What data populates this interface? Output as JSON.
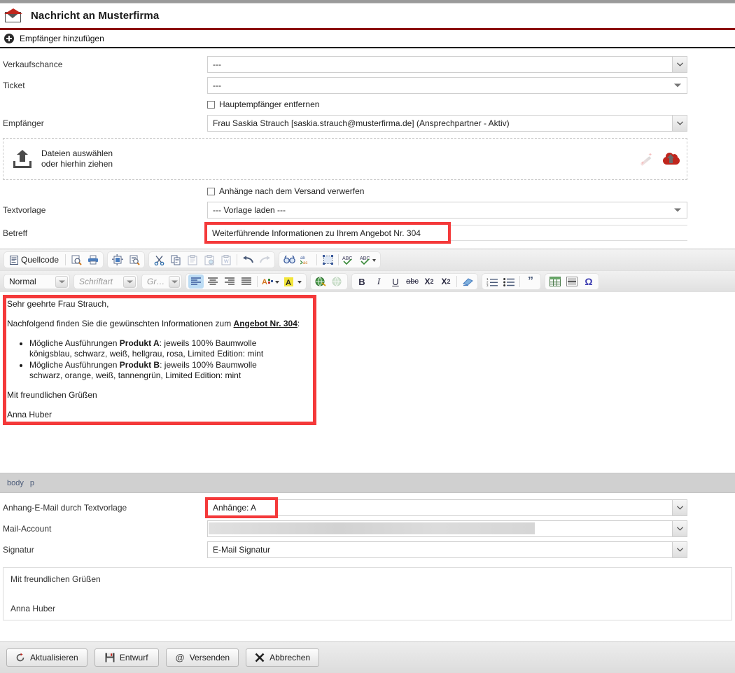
{
  "window": {
    "title": "Nachricht an Musterfirma",
    "icon": "envelope-icon"
  },
  "add_recipient": {
    "label": "Empfänger hinzufügen",
    "icon": "plus-circle-icon"
  },
  "form": {
    "verkaufschance": {
      "label": "Verkaufschance",
      "value": "---"
    },
    "ticket": {
      "label": "Ticket",
      "value": "---"
    },
    "hauptempfaenger": {
      "label": "Hauptempfänger entfernen",
      "checked": false
    },
    "empfaenger": {
      "label": "Empfänger",
      "value": "Frau Saskia Strauch [saskia.strauch@musterfirma.de] (Ansprechpartner - Aktiv)"
    },
    "dropzone": {
      "line1": "Dateien auswählen",
      "line2": "oder hierhin ziehen",
      "upload_icon": "upload-tray-icon",
      "wand_icon": "magic-wand-icon",
      "cloud_icon": "cloud-upload-icon"
    },
    "anhaenge_verwerfen": {
      "label": "Anhänge nach dem Versand verwerfen",
      "checked": false
    },
    "textvorlage": {
      "label": "Textvorlage",
      "value": "--- Vorlage laden ---"
    },
    "betreff": {
      "label": "Betreff",
      "value": "Weiterführende Informationen zu Ihrem Angebot Nr. 304",
      "highlighted": true
    }
  },
  "editor": {
    "toolbar_row1": {
      "source_label": "Quellcode",
      "groups": [
        {
          "buttons": [
            {
              "name": "source-code-button",
              "label": "Quellcode",
              "glyph": "▤"
            },
            {
              "name": "preview-button",
              "glyph": "🔍"
            },
            {
              "name": "print-button",
              "glyph": "🖶"
            }
          ]
        },
        {
          "buttons": [
            {
              "name": "templates-button",
              "glyph": "▣"
            },
            {
              "name": "document-properties-button",
              "glyph": "🗎"
            }
          ]
        },
        {
          "buttons": [
            {
              "name": "cut-button",
              "glyph": "✂"
            },
            {
              "name": "copy-button",
              "glyph": "⧉"
            },
            {
              "name": "paste-button",
              "glyph": "📋"
            },
            {
              "name": "paste-as-plain-text-button",
              "glyph": "📋"
            },
            {
              "name": "paste-from-word-button",
              "glyph": "📋"
            },
            {
              "name": "undo-button",
              "glyph": "↰"
            },
            {
              "name": "redo-button",
              "glyph": "↱"
            }
          ]
        },
        {
          "buttons": [
            {
              "name": "find-button",
              "glyph": "🔭"
            },
            {
              "name": "replace-button",
              "glyph": "ab"
            },
            {
              "name": "select-all-button",
              "glyph": "⬚"
            },
            {
              "name": "spellcheck-button",
              "glyph": "ABC"
            },
            {
              "name": "spellcheck-options-button",
              "glyph": "ABC"
            }
          ]
        }
      ]
    },
    "toolbar_row2": {
      "format_value": "Normal",
      "font_value": "Schriftart",
      "size_value": "Gr…",
      "buttons": [
        {
          "name": "align-left-button",
          "glyph": "≡",
          "active": true
        },
        {
          "name": "align-center-button",
          "glyph": "≡"
        },
        {
          "name": "align-right-button",
          "glyph": "≡"
        },
        {
          "name": "align-justify-button",
          "glyph": "≡"
        },
        {
          "name": "text-color-button",
          "glyph": "A"
        },
        {
          "name": "background-color-button",
          "glyph": "A"
        },
        {
          "name": "insert-link-button",
          "glyph": "🜨"
        },
        {
          "name": "unlink-button",
          "glyph": "🜨"
        },
        {
          "name": "bold-button",
          "glyph": "B"
        },
        {
          "name": "italic-button",
          "glyph": "I"
        },
        {
          "name": "underline-button",
          "glyph": "U"
        },
        {
          "name": "strikethrough-button",
          "glyph": "abc"
        },
        {
          "name": "subscript-button",
          "glyph": "X₂"
        },
        {
          "name": "superscript-button",
          "glyph": "X²"
        },
        {
          "name": "remove-format-button",
          "glyph": "🧽"
        },
        {
          "name": "numbered-list-button",
          "glyph": "1≡"
        },
        {
          "name": "bulleted-list-button",
          "glyph": "•≡"
        },
        {
          "name": "blockquote-button",
          "glyph": "❞"
        },
        {
          "name": "table-button",
          "glyph": "⊞"
        },
        {
          "name": "horizontal-rule-button",
          "glyph": "▤"
        },
        {
          "name": "special-char-button",
          "glyph": "Ω"
        }
      ]
    },
    "content": {
      "greeting": "Sehr geehrte Frau Strauch,",
      "intro_before": "Nachfolgend finden Sie die gewünschten Informationen zum ",
      "intro_link": "Angebot Nr. 304",
      "intro_after": ":",
      "bullets": [
        {
          "prefix": "Mögliche Ausführungen ",
          "strong": "Produkt A",
          "suffix": ": jeweils 100% Baumwolle",
          "second_line": "königsblau, schwarz, weiß, hellgrau, rosa, Limited Edition: mint"
        },
        {
          "prefix": "Mögliche Ausführungen ",
          "strong": "Produkt B",
          "suffix": ": jeweils 100% Baumwolle",
          "second_line": "schwarz, orange, weiß, tannengrün, Limited Edition: mint"
        }
      ],
      "closing": "Mit freundlichen Grüßen",
      "sender": "Anna Huber"
    },
    "status_path": [
      "body",
      "p"
    ]
  },
  "bottom": {
    "anhang_email": {
      "label": "Anhang-E-Mail durch Textvorlage",
      "value": "Anhänge: A",
      "highlighted": true
    },
    "mail_account": {
      "label": "Mail-Account",
      "value": ""
    },
    "signatur": {
      "label": "Signatur",
      "value": "E-Mail Signatur"
    },
    "signature_preview": {
      "line1": "Mit freundlichen Grüßen",
      "line2": "Anna Huber"
    }
  },
  "footer": {
    "buttons": [
      {
        "name": "refresh-button",
        "label": "Aktualisieren",
        "icon": "refresh-icon"
      },
      {
        "name": "draft-button",
        "label": "Entwurf",
        "icon": "floppy-disk-icon"
      },
      {
        "name": "send-button",
        "label": "Versenden",
        "icon": "at-sign-icon"
      },
      {
        "name": "cancel-button",
        "label": "Abbrechen",
        "icon": "x-icon"
      }
    ]
  },
  "colors": {
    "accent_red": "#8c1010",
    "highlight_red": "#f4393a",
    "toolbar_bg": "#e8e8e8",
    "status_bg": "#d0d0d0"
  }
}
